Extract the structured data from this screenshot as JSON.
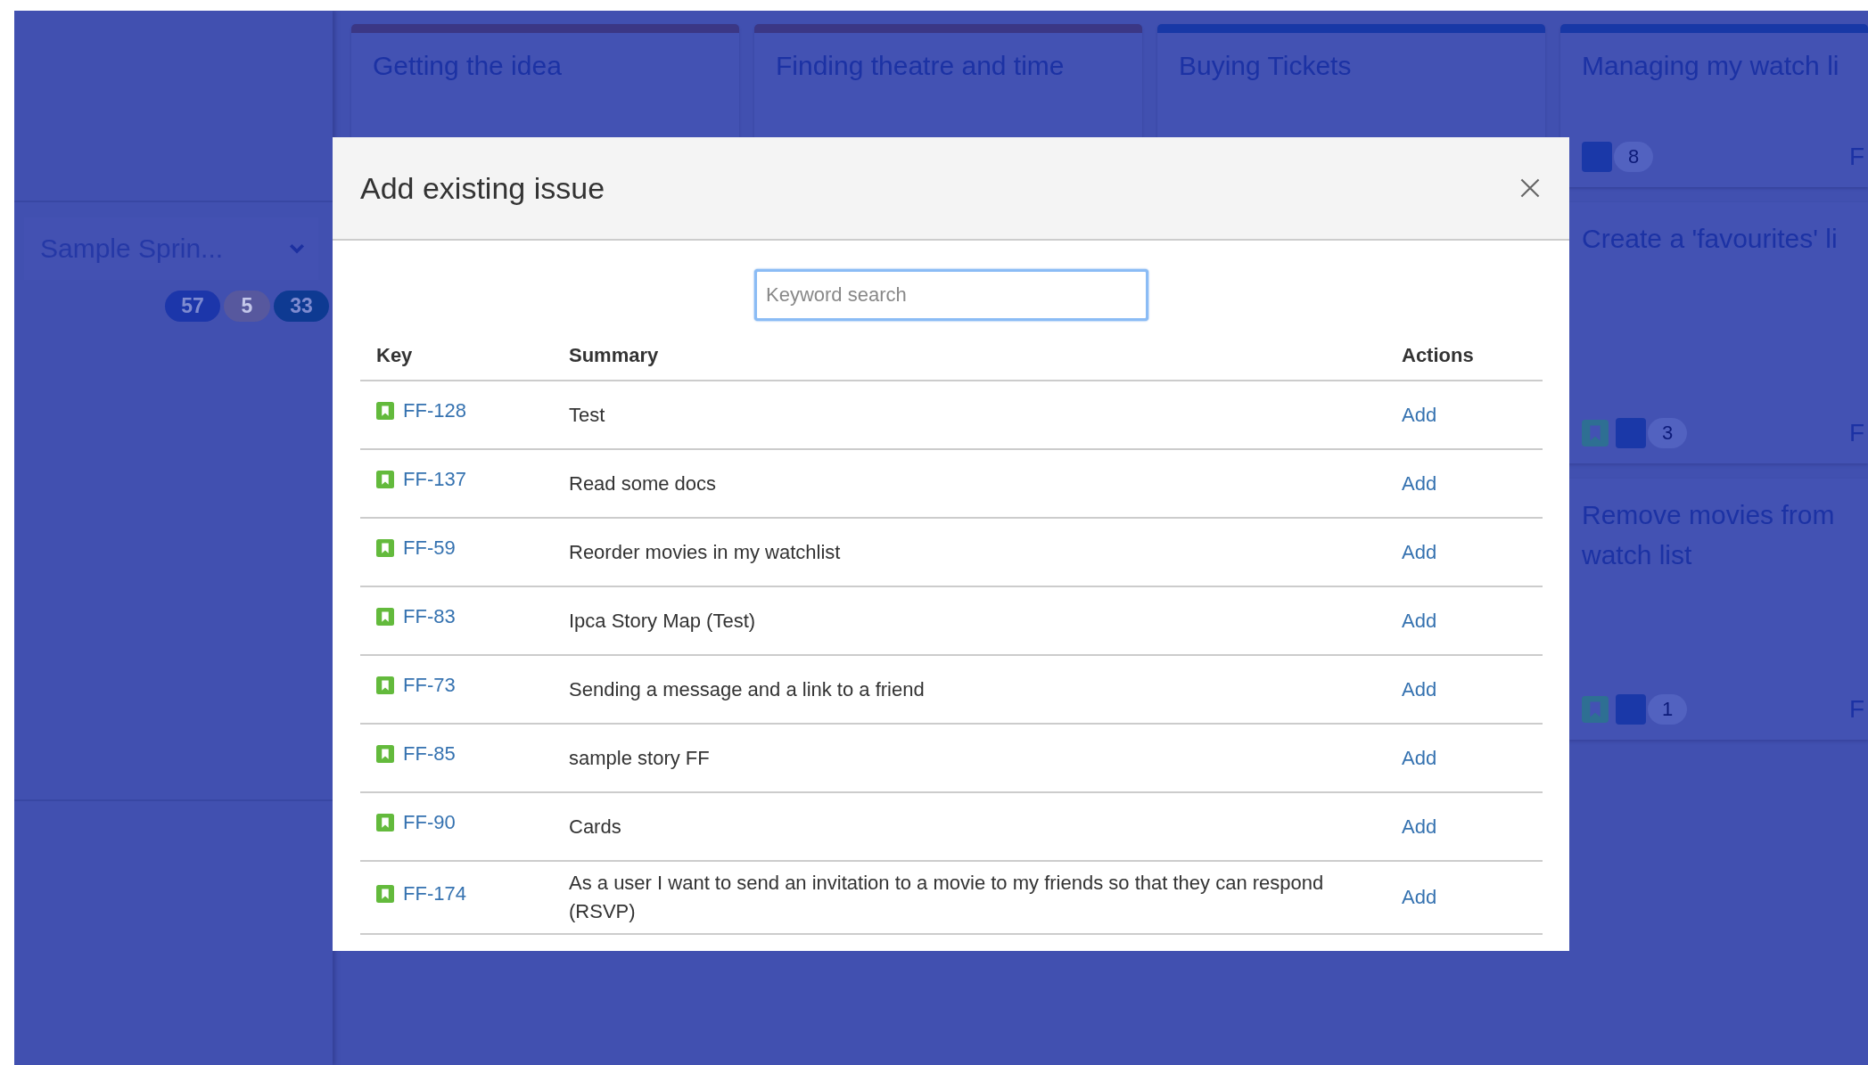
{
  "board": {
    "sprint": {
      "name": "Sample Sprin...",
      "counts": [
        {
          "value": "57",
          "kind": "todo"
        },
        {
          "value": "5",
          "kind": "progress"
        },
        {
          "value": "33",
          "kind": "done"
        }
      ]
    },
    "epics": [
      {
        "title": "Getting the idea",
        "color": "#3b3785"
      },
      {
        "title": "Finding theatre and time",
        "color": "#3b3785"
      },
      {
        "title": "Buying Tickets",
        "color": "#1838a6"
      },
      {
        "title": "Managing my watch li",
        "color": "#1838a6",
        "count": "8",
        "key": "F"
      }
    ],
    "cards": [
      {
        "title": "Create a 'favourites' li",
        "count": "3",
        "key": "F"
      },
      {
        "title": "Remove movies from watch list",
        "count": "1",
        "key": "F"
      }
    ]
  },
  "dialog": {
    "title": "Add existing issue",
    "search": {
      "placeholder": "Keyword search",
      "focused": true
    },
    "columns": [
      "Key",
      "Summary",
      "Actions"
    ],
    "rows": [
      {
        "key": "FF-128",
        "summary": "Test",
        "action": "Add"
      },
      {
        "key": "FF-137",
        "summary": "Read some docs",
        "action": "Add"
      },
      {
        "key": "FF-59",
        "summary": "Reorder movies in my watchlist",
        "action": "Add"
      },
      {
        "key": "FF-83",
        "summary": "Ipca Story Map (Test)",
        "action": "Add"
      },
      {
        "key": "FF-73",
        "summary": "Sending a message and a link to a friend",
        "action": "Add"
      },
      {
        "key": "FF-85",
        "summary": "sample story FF",
        "action": "Add"
      },
      {
        "key": "FF-90",
        "summary": "Cards",
        "action": "Add"
      },
      {
        "key": "FF-174",
        "summary": "As a user I want to send an invitation to a movie to my friends so that they can respond (RSVP)",
        "action": "Add"
      }
    ]
  }
}
